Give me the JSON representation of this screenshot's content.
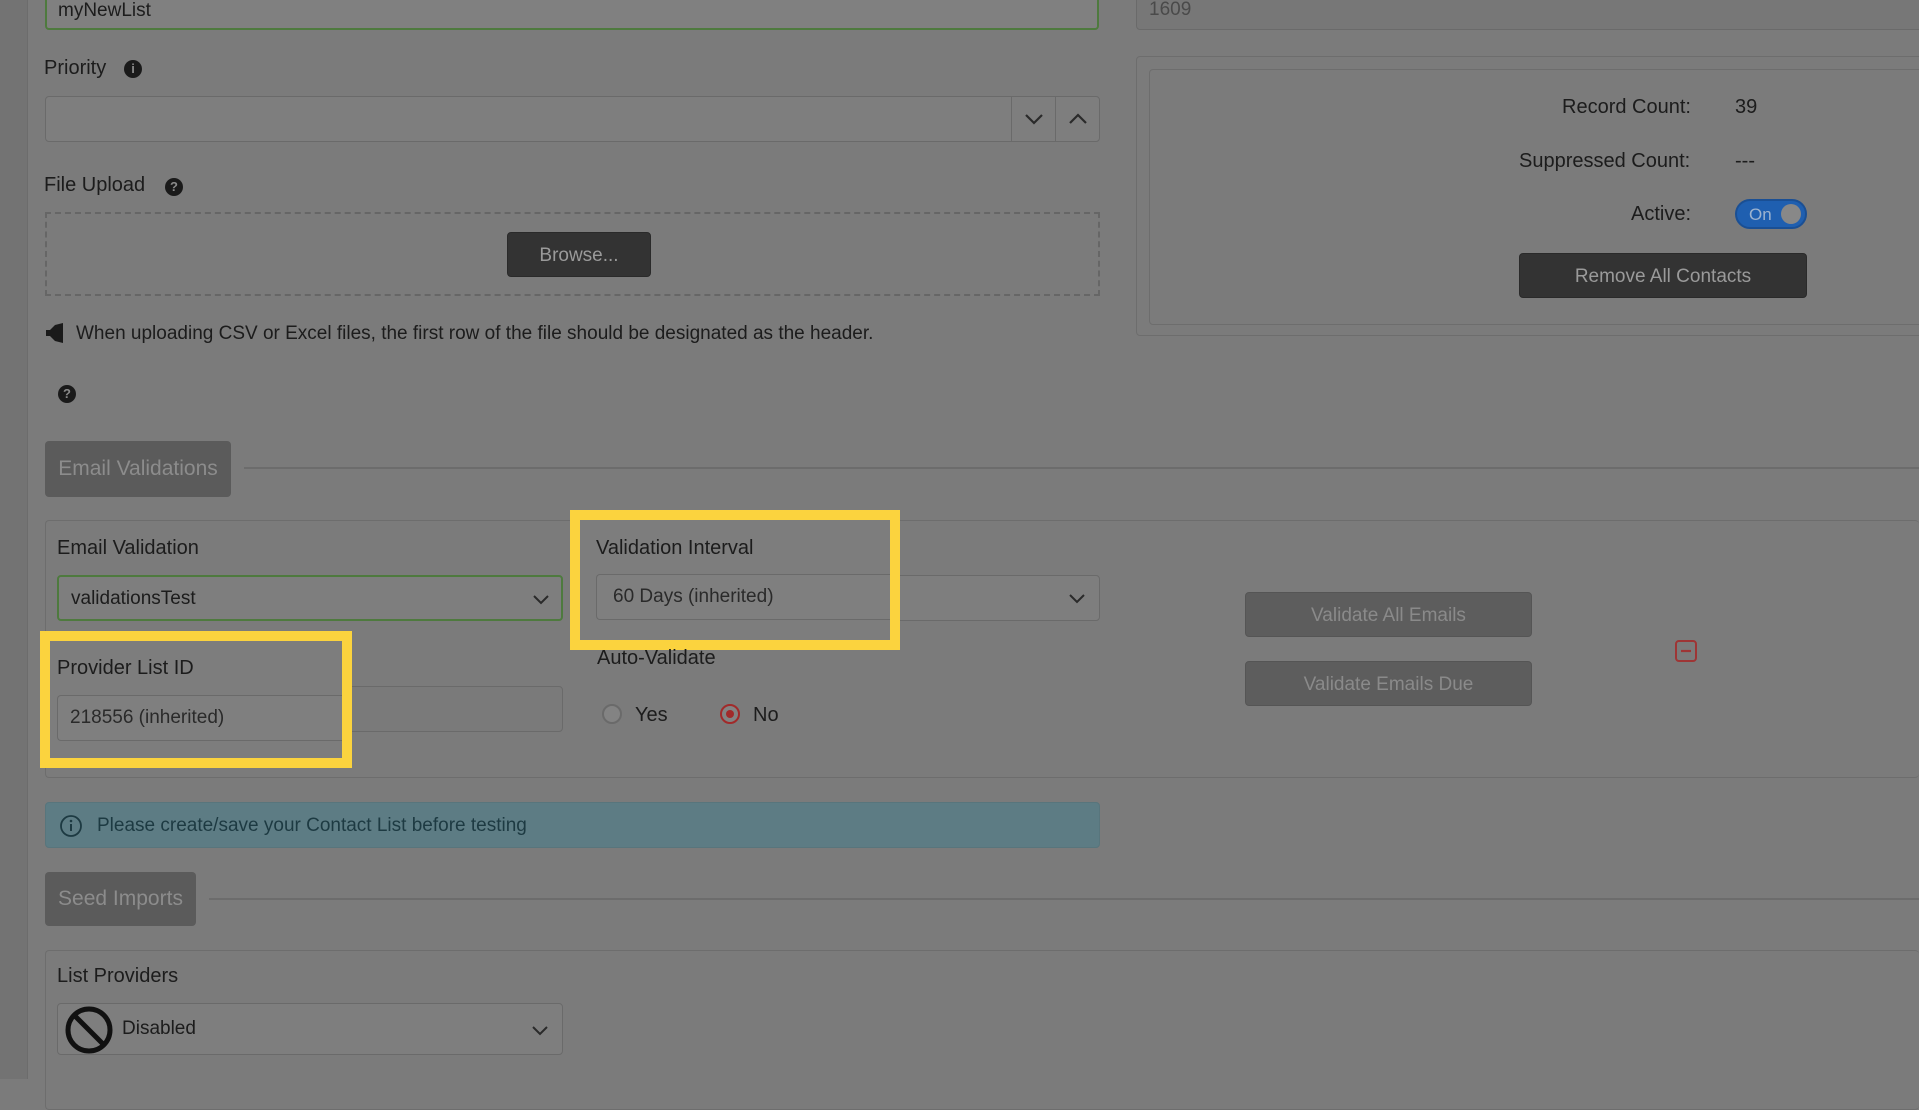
{
  "form": {
    "list_name_value": "myNewList",
    "list_id_value": "1609",
    "priority_label": "Priority",
    "file_upload_label": "File Upload",
    "browse_label": "Browse...",
    "upload_note": "When uploading CSV or Excel files, the first row of the file should be designated as the header."
  },
  "stats": {
    "record_count_label": "Record Count:",
    "record_count_value": "39",
    "suppressed_count_label": "Suppressed Count:",
    "suppressed_count_value": "---",
    "active_label": "Active:",
    "active_toggle_text": "On",
    "remove_all_label": "Remove All Contacts"
  },
  "email_validations": {
    "section_label": "Email Validations",
    "email_validation_label": "Email Validation",
    "email_validation_value": "validationsTest",
    "validation_interval_label": "Validation Interval",
    "validation_interval_value": "60 Days (inherited)",
    "provider_list_id_label": "Provider List ID",
    "provider_list_id_value": "218556 (inherited)",
    "auto_validate_label": "Auto-Validate",
    "auto_validate_yes": "Yes",
    "auto_validate_no": "No",
    "auto_validate_selected": "No",
    "validate_all_label": "Validate All Emails",
    "validate_due_label": "Validate Emails Due",
    "info_message": "Please create/save your Contact List before testing"
  },
  "seed_imports": {
    "section_label": "Seed Imports",
    "list_providers_label": "List Providers",
    "list_providers_value": "Disabled"
  },
  "colors": {
    "highlight": "#fbd33e",
    "toggle_on": "#1f5fb0",
    "radio_selected": "#a12a2a",
    "info_bar": "#5d7c84"
  },
  "icons": [
    "info-icon",
    "help-icon",
    "megaphone-icon",
    "chevron-down-icon",
    "chevron-up-icon",
    "minus-square-icon",
    "disabled-icon"
  ]
}
